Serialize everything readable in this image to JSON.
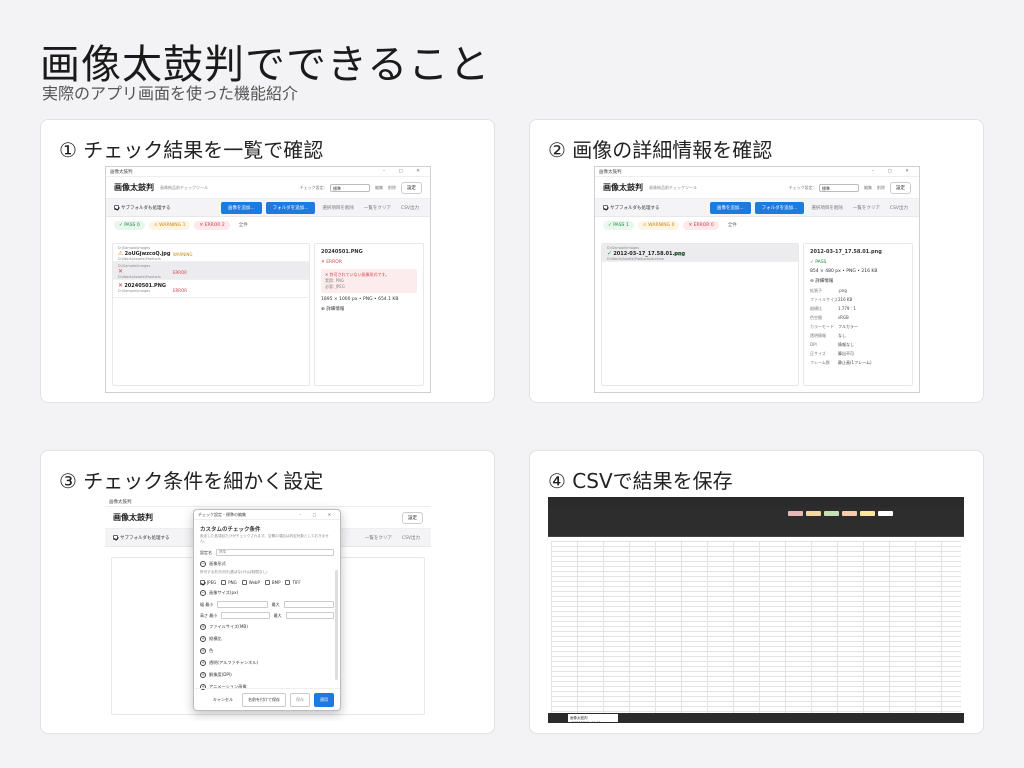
{
  "page": {
    "title": "画像太鼓判でできること",
    "subtitle": "実際のアプリ画面を使った機能紹介"
  },
  "app": {
    "window_title": "画像太鼓判",
    "name": "画像太鼓判",
    "tagline": "画像納品前チェックツール",
    "check_setting_label": "チェック設定:",
    "check_setting_value": "標準",
    "edit_label": "編集",
    "delete_label": "削除",
    "settings_button": "設定",
    "include_subfolders": "サブフォルダも処理する",
    "add_images": "画像を追加...",
    "add_folder": "フォルダを追加...",
    "remove_selected": "選択項目を削除",
    "clear_all": "一覧をクリア",
    "csv_export": "CSV出力",
    "filter_all": "全件"
  },
  "cards": [
    {
      "title": "① チェック結果を一覧で確認",
      "filters": {
        "pass": "✓ PASS 0",
        "warning": "⚠ WARNING 1",
        "error": "✕ ERROR 2"
      },
      "rows": [
        {
          "path": "D:\\Sample\\Images",
          "name": "2oUGjwzcoQ.jpg",
          "sub": "D:\\Work\\Assets\\Products",
          "status": "WARNING",
          "mark": "⚠"
        },
        {
          "path": "D:\\Sample\\Images",
          "name": "",
          "sub": "D:\\Work\\Assets\\Products",
          "status": "ERROR",
          "mark": "✕"
        },
        {
          "path": "",
          "name": "20240501.PNG",
          "sub": "D:\\Sample\\Images",
          "status": "ERROR",
          "mark": "✕"
        }
      ],
      "detail": {
        "filename": "20240501.PNG",
        "status": "✕ ERROR",
        "error_title": "✕ 許可されていない画像形式です。",
        "error_actual": "実際: PNG",
        "error_expected": "必要: JPEG",
        "dims": "1895 × 1000 px  •  PNG  •  654.1 KB",
        "more": "詳細情報"
      }
    },
    {
      "title": "② 画像の詳細情報を確認",
      "filters": {
        "pass": "✓ PASS 1",
        "warning": "⚠ WARNING 0",
        "error": "✕ ERROR 0"
      },
      "rows": [
        {
          "path": "D:\\Sample\\Images",
          "name": "2012-03-17_17.58.01.png",
          "sub": "D:\\Work\\Assets\\Products\\Archive",
          "status": "PASS",
          "mark": "✓"
        }
      ],
      "detail": {
        "filename": "2012-03-17_17.58.01.png",
        "status": "✓ PASS",
        "dims": "854 × 480 px  •  PNG  •  216 KB",
        "more": "詳細情報",
        "props": [
          {
            "k": "拡張子",
            "v": ".png"
          },
          {
            "k": "ファイルサイズ",
            "v": "216 KB"
          },
          {
            "k": "縦横比",
            "v": "1.779 : 1"
          },
          {
            "k": "色空間",
            "v": "sRGB"
          },
          {
            "k": "カラーモード",
            "v": "フルカラー"
          },
          {
            "k": "透明情報",
            "v": "なし"
          },
          {
            "k": "DPI",
            "v": "情報なし"
          },
          {
            "k": "圧サイズ",
            "v": "算出不可"
          },
          {
            "k": "フレーム数",
            "v": "静止画(1フレーム)"
          }
        ]
      }
    },
    {
      "title": "③ チェック条件を細かく設定",
      "dialog": {
        "window_title": "チェック設定 - 標準の編集",
        "heading": "カスタムのチェック条件",
        "note": "設定した各項目だけがチェックされます。空欄の項目は判定対象としておきません。",
        "name_label": "設定名",
        "name_placeholder": "標準",
        "sec_format": "画像形式",
        "format_note": "許可する形式(何も選ばなければ制限なし)",
        "formats": [
          "JPEG",
          "PNG",
          "WebP",
          "BMP",
          "TIFF"
        ],
        "sec_size": "画像サイズ(px)",
        "w_min": "幅 最小",
        "w_max": "最大",
        "h_min": "高さ 最小",
        "h_max": "最大",
        "sec_filesize": "ファイルサイズ(MB)",
        "sec_ratio": "縦横比",
        "sec_color": "色",
        "sec_alpha": "透明(アルファチャンネル)",
        "sec_dpi": "解像度(DPI)",
        "sec_anim": "アニメーション画像",
        "cancel": "キャンセル",
        "save_as": "名前を付けて保存",
        "save": "保存",
        "apply": "適用"
      }
    },
    {
      "title": "④ CSVで結果を保存",
      "excel": {
        "sheet_tab": "画像太鼓判_20260512_1148.csv"
      }
    }
  ],
  "colors": {
    "primary": "#1f7ae0",
    "pass": "#1e8a3c",
    "warning": "#c98a0f",
    "error": "#d23c48"
  }
}
